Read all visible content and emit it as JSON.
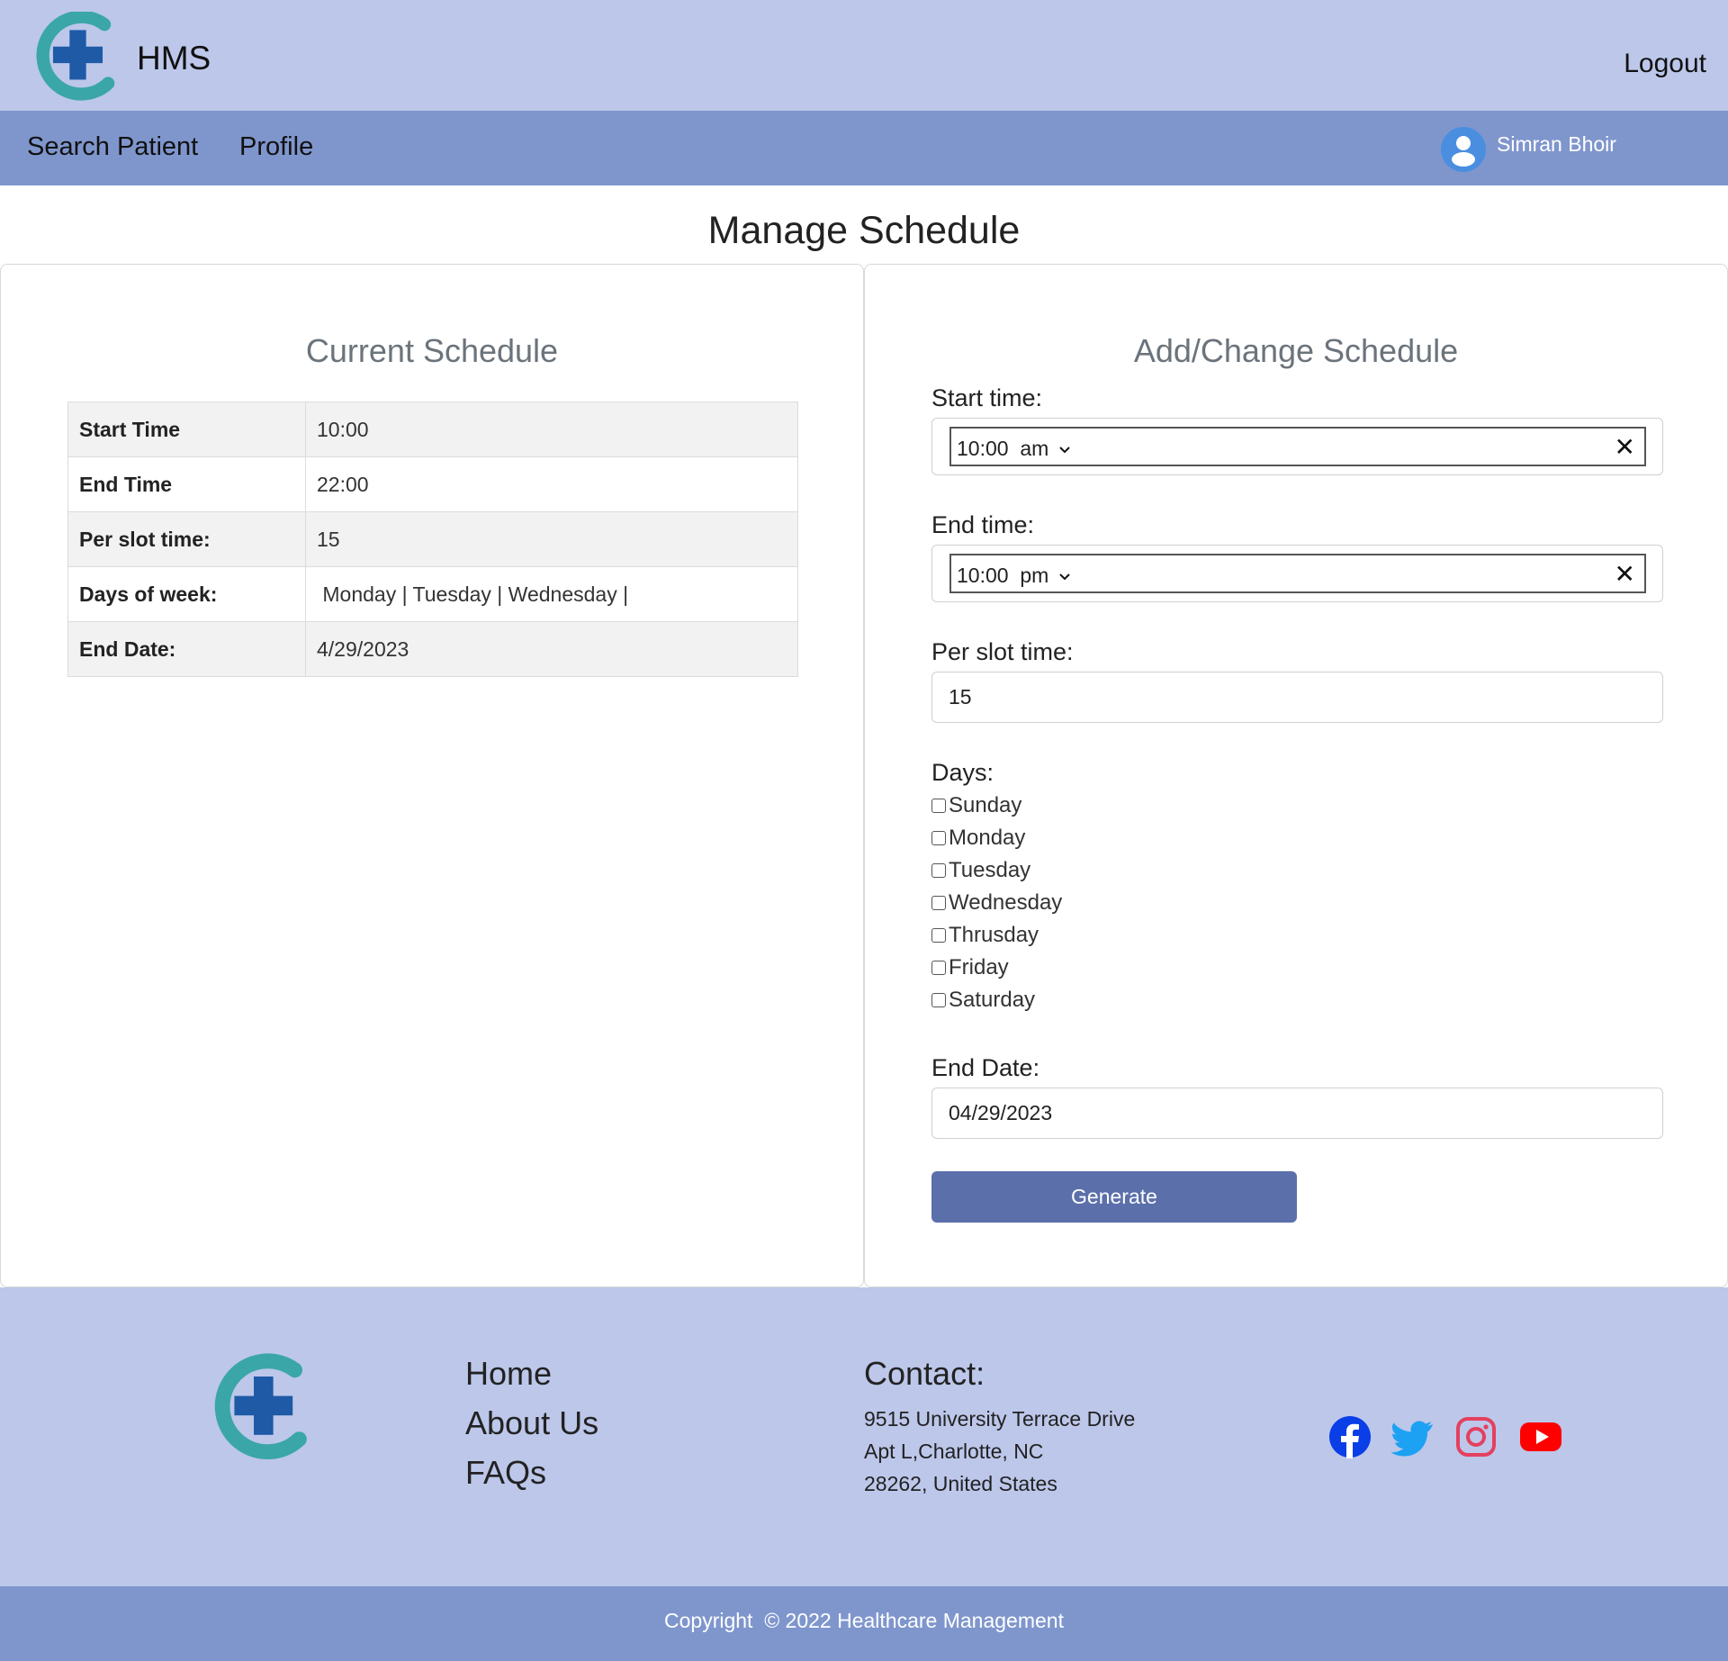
{
  "header": {
    "brand": "HMS",
    "logout": "Logout"
  },
  "nav": {
    "items": [
      "Search Patient",
      "Profile"
    ],
    "user_name": "Simran Bhoir"
  },
  "page": {
    "title": "Manage Schedule"
  },
  "current_schedule": {
    "heading": "Current Schedule",
    "rows": [
      {
        "label": "Start Time",
        "value": "10:00"
      },
      {
        "label": "End Time",
        "value": "22:00"
      },
      {
        "label": "Per slot time:",
        "value": "15"
      },
      {
        "label": "Days of week:",
        "value": " Monday | Tuesday | Wednesday |"
      },
      {
        "label": "End Date:",
        "value": "4/29/2023"
      }
    ]
  },
  "form": {
    "heading": "Add/Change Schedule",
    "start_time": {
      "label": "Start time:",
      "time": "10:00",
      "ampm": "am",
      "clear": "✕"
    },
    "end_time": {
      "label": "End time:",
      "time": "10:00",
      "ampm": "pm",
      "clear": "✕"
    },
    "slot": {
      "label": "Per slot time:",
      "value": "15"
    },
    "days": {
      "label": "Days:",
      "options": [
        "Sunday",
        "Monday",
        "Tuesday",
        "Wednesday",
        "Thrusday",
        "Friday",
        "Saturday"
      ]
    },
    "end_date": {
      "label": "End Date:",
      "value": "04/29/2023"
    },
    "submit": "Generate"
  },
  "footer": {
    "links": [
      "Home",
      "About Us",
      "FAQs"
    ],
    "contact_heading": "Contact:",
    "address": [
      "9515 University Terrace Drive",
      "Apt L,Charlotte, NC",
      "28262, United States"
    ],
    "social": [
      "facebook-icon",
      "twitter-icon",
      "instagram-icon",
      "youtube-icon"
    ],
    "copyright": "Copyright  © 2022 Healthcare Management"
  },
  "colors": {
    "header_bg": "#bcc7ea",
    "nav_bg": "#7f96cd",
    "button_bg": "#5b6fab",
    "logo_teal": "#3aa6a8",
    "logo_blue": "#1e5aa6"
  }
}
